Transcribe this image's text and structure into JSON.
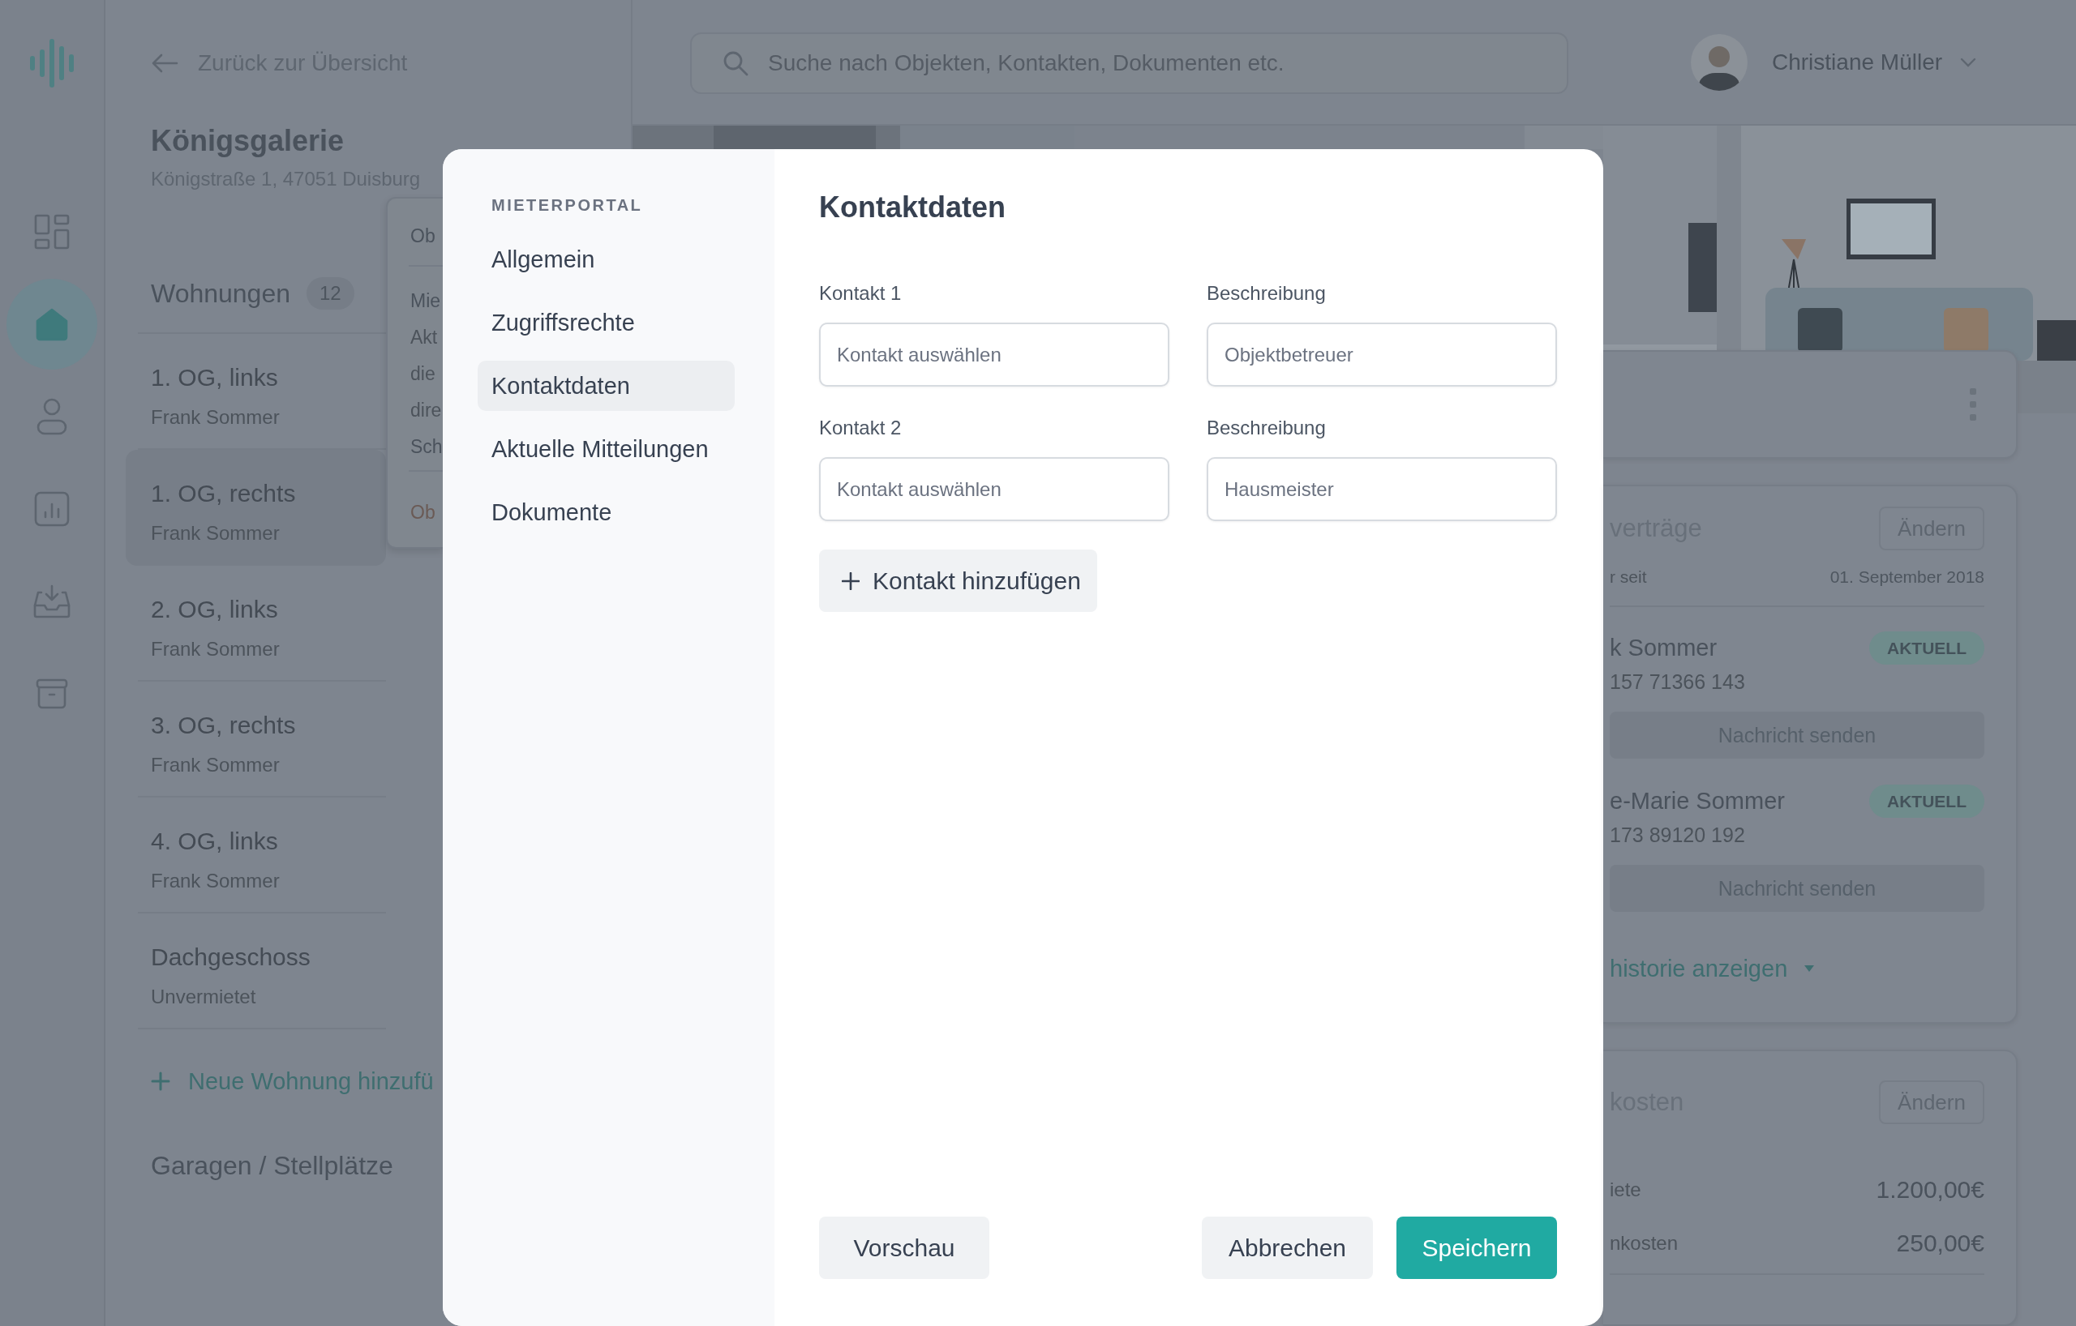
{
  "sidebar": {
    "items": [
      {
        "kind": "grid",
        "selected": false
      },
      {
        "kind": "home",
        "selected": true
      },
      {
        "kind": "person",
        "selected": false
      },
      {
        "kind": "chart",
        "selected": false
      },
      {
        "kind": "inbox",
        "selected": false
      },
      {
        "kind": "archive",
        "selected": false
      }
    ]
  },
  "back_link": "Zurück zur Übersicht",
  "property": {
    "name": "Königsgalerie",
    "address": "Königstraße 1, 47051 Duisburg"
  },
  "units": {
    "title": "Wohnungen",
    "count": "12",
    "items": [
      {
        "name": "1. OG, links",
        "tenant": "Frank Sommer",
        "selected": false
      },
      {
        "name": "1. OG, rechts",
        "tenant": "Frank Sommer",
        "selected": true
      },
      {
        "name": "2. OG, links",
        "tenant": "Frank Sommer",
        "selected": false
      },
      {
        "name": "3. OG, rechts",
        "tenant": "Frank Sommer",
        "selected": false
      },
      {
        "name": "4. OG, links",
        "tenant": "Frank Sommer",
        "selected": false
      },
      {
        "name": "Dachgeschoss",
        "tenant": "Unvermietet",
        "selected": false
      }
    ],
    "add_label": "Neue Wohnung hinzufü"
  },
  "garages": {
    "title": "Garagen / Stellplätze"
  },
  "popover": {
    "sections": [
      [
        {
          "text": "Ob",
          "kind": "title"
        }
      ],
      [
        {
          "text": "Mie",
          "kind": "title"
        },
        {
          "text": "Akt",
          "kind": "body"
        },
        {
          "text": "die",
          "kind": "body"
        },
        {
          "text": "dire",
          "kind": "body"
        },
        {
          "text": "Sch",
          "kind": "title"
        }
      ],
      [
        {
          "text": "Ob",
          "kind": "link"
        }
      ]
    ]
  },
  "search": {
    "placeholder": "Suche nach Objekten, Kontakten, Dokumenten etc."
  },
  "user": {
    "name": "Christiane Müller"
  },
  "modal": {
    "nav_heading": "MIETERPORTAL",
    "nav": [
      {
        "label": "Allgemein",
        "selected": false
      },
      {
        "label": "Zugriffsrechte",
        "selected": false
      },
      {
        "label": "Kontaktdaten",
        "selected": true
      },
      {
        "label": "Aktuelle Mitteilungen",
        "selected": false
      },
      {
        "label": "Dokumente",
        "selected": false
      }
    ],
    "title": "Kontaktdaten",
    "contacts": [
      {
        "label": "Kontakt 1",
        "placeholder": "Kontakt auswählen",
        "description_label": "Beschreibung",
        "description_placeholder": "Objektbetreuer"
      },
      {
        "label": "Kontakt 2",
        "placeholder": "Kontakt auswählen",
        "description_label": "Beschreibung",
        "description_placeholder": "Hausmeister"
      }
    ],
    "add_button": "Kontakt hinzufügen",
    "preview_button": "Vorschau",
    "cancel_button": "Abbrechen",
    "save_button": "Speichern"
  },
  "contracts_card": {
    "title": "verträge",
    "edit_button": "Ändern",
    "since_label": "r seit",
    "since_value": "01. September 2018",
    "tenants": [
      {
        "name": "k Sommer",
        "badge": "AKTUELL",
        "phone": "157 71366 143",
        "button": "Nachricht senden"
      },
      {
        "name": "e-Marie Sommer",
        "badge": "AKTUELL",
        "phone": "173 89120 192",
        "button": "Nachricht senden"
      }
    ],
    "history_link": "historie anzeigen"
  },
  "costs_card": {
    "title": "kosten",
    "edit_button": "Ändern",
    "rows": [
      {
        "label": "iete",
        "value": "1.200,00€"
      },
      {
        "label": "nkosten",
        "value": "250,00€"
      }
    ]
  }
}
